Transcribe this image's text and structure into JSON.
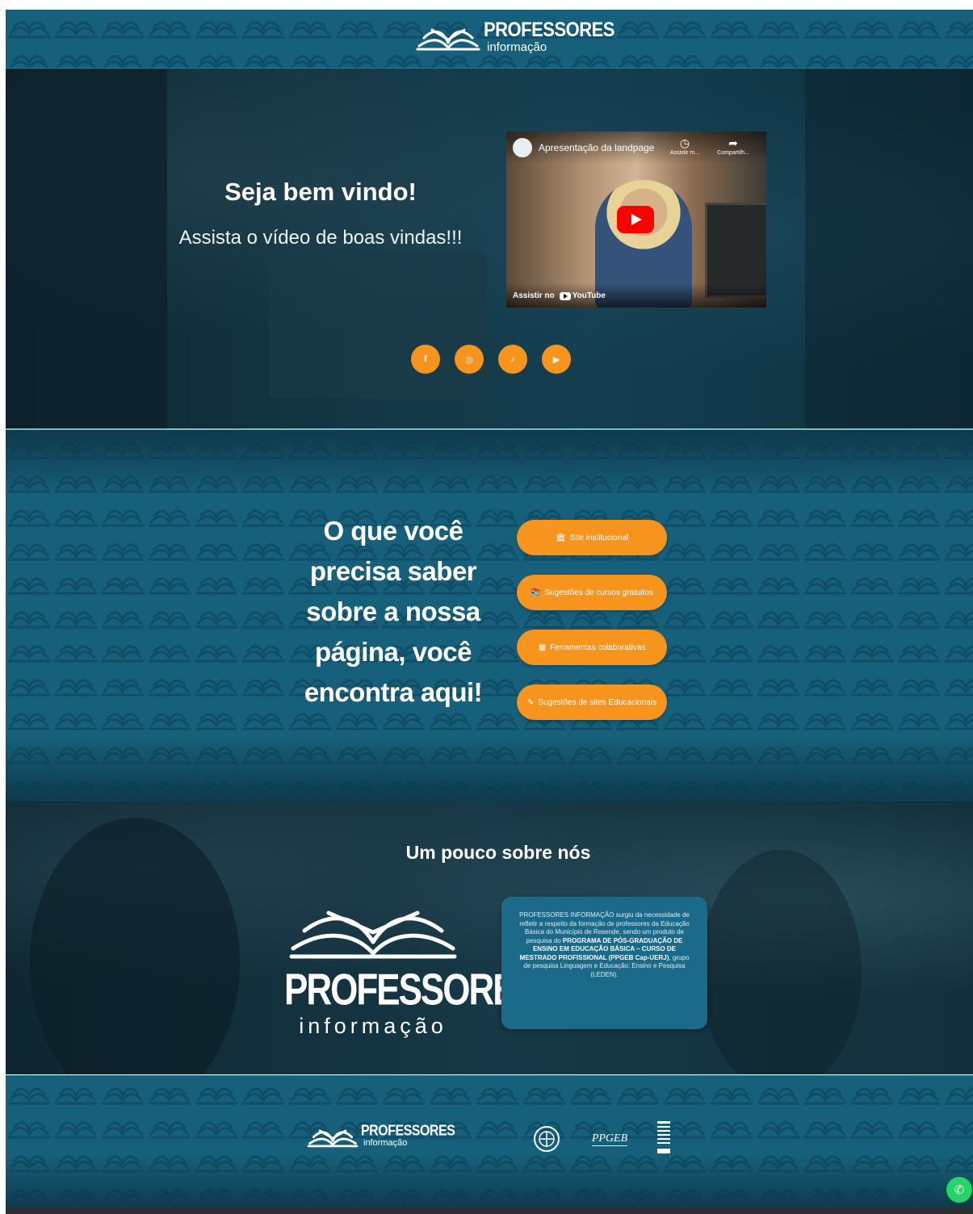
{
  "header": {
    "logo_title": "PROFESSORES",
    "logo_sub": "informação"
  },
  "hero": {
    "title": "Seja bem vindo!",
    "subtitle": "Assista o vídeo de boas vindas!!!",
    "video": {
      "title": "Apresentação da landpage",
      "watch_later": "Assistir m...",
      "share": "Compartilh...",
      "watch_on": "Assistir no",
      "platform": "YouTube"
    },
    "socials": [
      {
        "name": "facebook-icon",
        "glyph": "f"
      },
      {
        "name": "instagram-icon",
        "glyph": "◎"
      },
      {
        "name": "tiktok-icon",
        "glyph": "♪"
      },
      {
        "name": "youtube-icon",
        "glyph": "▶"
      }
    ]
  },
  "middle": {
    "heading_lines": [
      "O que você",
      "precisa saber",
      "sobre a nossa",
      "página, você",
      "encontra aqui!"
    ],
    "buttons": [
      {
        "icon": "🏛",
        "label": "Site institucional"
      },
      {
        "icon": "📚",
        "label": "Sugestões de cursos gratuitos"
      },
      {
        "icon": "▦",
        "label": "Ferramentas colaborativas"
      },
      {
        "icon": "✎",
        "label": "Sugestões de sites Educacionais"
      }
    ]
  },
  "about": {
    "title": "Um pouco sobre nós",
    "logo_title": "PROFESSORES",
    "logo_sub": "informação",
    "text_1": "PROFESSORES INFORMAÇÃO surgiu da necessidade de refletir a respeito da formação de professores da Educação Básica do Município de Resende, sendo um produto de pesquisa do ",
    "text_bold": "PROGRAMA DE PÓS-GRADUAÇÃO DE ENSINO EM EDUCAÇÃO BÁSICA – CURSO DE MESTRADO PROFISSIONAL (PPGEB Cap-UERJ)",
    "text_2": ", grupo de pesquisa Linguagem e Educação: Ensino e Pesquisa (LEDEN)."
  },
  "footer": {
    "logo_title": "PROFESSORES",
    "logo_sub": "informação",
    "ppgeb": "PPGEB"
  },
  "colors": {
    "teal": "#17607c",
    "orange": "#f7941d",
    "dark": "#0e3a4c"
  }
}
